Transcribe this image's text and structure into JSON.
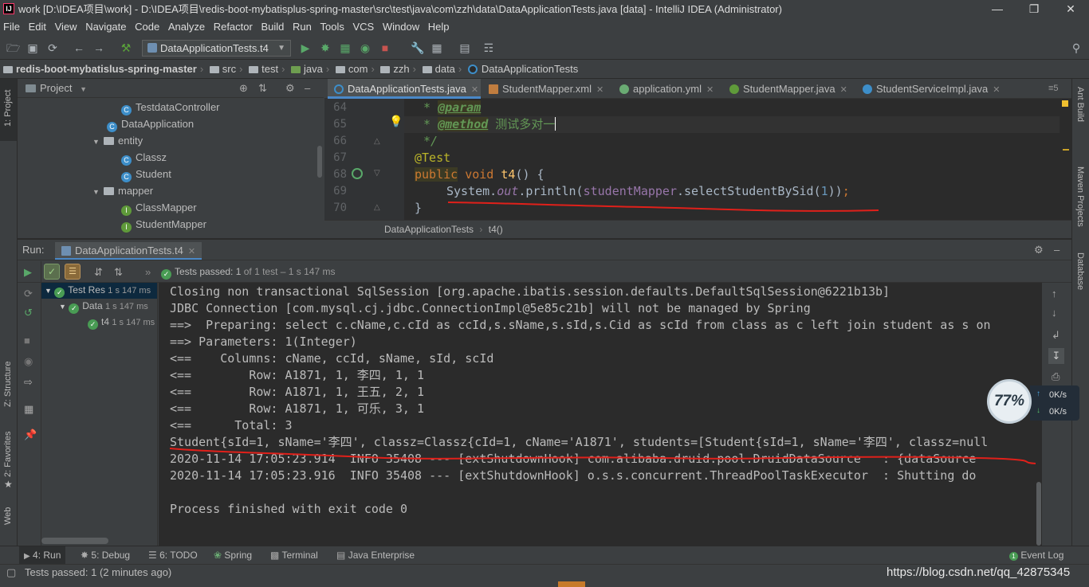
{
  "window": {
    "title": "work [D:\\IDEA项目\\work] - D:\\IDEA项目\\redis-boot-mybatisplus-spring-master\\src\\test\\java\\com\\zzh\\data\\DataApplicationTests.java [data] - IntelliJ IDEA (Administrator)",
    "app_icon": "IJ"
  },
  "menu": [
    "File",
    "Edit",
    "View",
    "Navigate",
    "Code",
    "Analyze",
    "Refactor",
    "Build",
    "Run",
    "Tools",
    "VCS",
    "Window",
    "Help"
  ],
  "toolbar": {
    "run_config": "DataApplicationTests.t4"
  },
  "breadcrumb": [
    "redis-boot-mybatislus-spring-master",
    "src",
    "test",
    "java",
    "com",
    "zzh",
    "data",
    "DataApplicationTests"
  ],
  "left_stripe": {
    "project": "1: Project",
    "structure": "Z: Structure",
    "favorites": "2: Favorites",
    "web": "Web"
  },
  "right_stripe": {
    "ant": "Ant Build",
    "maven": "Maven Projects",
    "database": "Database"
  },
  "project_panel": {
    "title": "Project",
    "items": [
      {
        "label": "TestdataController",
        "kind": "class"
      },
      {
        "label": "DataApplication",
        "kind": "class"
      },
      {
        "label": "entity",
        "kind": "package"
      },
      {
        "label": "Classz",
        "kind": "class"
      },
      {
        "label": "Student",
        "kind": "class"
      },
      {
        "label": "mapper",
        "kind": "package"
      },
      {
        "label": "ClassMapper",
        "kind": "interface"
      },
      {
        "label": "StudentMapper",
        "kind": "interface"
      }
    ]
  },
  "editor": {
    "tabs": [
      {
        "label": "DataApplicationTests.java",
        "active": true
      },
      {
        "label": "StudentMapper.xml",
        "active": false
      },
      {
        "label": "application.yml",
        "active": false
      },
      {
        "label": "StudentMapper.java",
        "active": false
      },
      {
        "label": "StudentServiceImpl.java",
        "active": false
      }
    ],
    "line_numbers": [
      "64",
      "65",
      "66",
      "67",
      "68",
      "69",
      "70"
    ],
    "code": {
      "l64_star": "* ",
      "l64_tag": "@param",
      "l65_star": "* ",
      "l65_tag": "@method",
      "l65_text": " 测试多对一",
      "l66": "*/",
      "l67": "@Test",
      "l68_kw1": "public",
      "l68_kw2": " void ",
      "l68_fn": "t4",
      "l68_rest": "() {",
      "l69_a": "System.",
      "l69_out": "out",
      "l69_b": ".println(",
      "l69_field": "studentMapper",
      "l69_c": ".selectStudentBySid(",
      "l69_num": "1",
      "l69_d": "))",
      "l69_semi": ";",
      "l70": "}"
    },
    "crumb_class": "DataApplicationTests",
    "crumb_method": "t4()"
  },
  "run": {
    "label": "Run:",
    "tab": "DataApplicationTests.t4",
    "status_prefix": "Tests passed:",
    "status_count": "1",
    "status_suffix": "of 1 test – 1 s 147 ms",
    "tree": [
      {
        "label": "Test Res",
        "time": "1 s 147 ms"
      },
      {
        "label": "Data",
        "time": "1 s 147 ms"
      },
      {
        "label": "t4",
        "time": "1 s 147 ms"
      }
    ],
    "console": [
      "Closing non transactional SqlSession [org.apache.ibatis.session.defaults.DefaultSqlSession@6221b13b]",
      "JDBC Connection [com.mysql.cj.jdbc.ConnectionImpl@5e85c21b] will not be managed by Spring",
      "==>  Preparing: select c.cName,c.cId as ccId,s.sName,s.sId,s.Cid as scId from class as c left join student as s on",
      "==> Parameters: 1(Integer)",
      "<==    Columns: cName, ccId, sName, sId, scId",
      "<==        Row: A1871, 1, 李四, 1, 1",
      "<==        Row: A1871, 1, 王五, 2, 1",
      "<==        Row: A1871, 1, 可乐, 3, 1",
      "<==      Total: 3",
      "Student{sId=1, sName='李四', classz=Classz{cId=1, cName='A1871', students=[Student{sId=1, sName='李四', classz=null",
      "2020-11-14 17:05:23.914  INFO 35408 --- [extShutdownHook] com.alibaba.druid.pool.DruidDataSource   : {dataSource",
      "2020-11-14 17:05:23.916  INFO 35408 --- [extShutdownHook] o.s.s.concurrent.ThreadPoolTaskExecutor  : Shutting do",
      "",
      "Process finished with exit code 0"
    ]
  },
  "bottom_tabs": [
    {
      "label": "4: Run",
      "active": true
    },
    {
      "label": "5: Debug",
      "active": false
    },
    {
      "label": "6: TODO",
      "active": false
    },
    {
      "label": "Spring",
      "active": false
    },
    {
      "label": "Terminal",
      "active": false
    },
    {
      "label": "Java Enterprise",
      "active": false
    }
  ],
  "event_log": "Event Log",
  "status": {
    "text": "Tests passed: 1 (2 minutes ago)",
    "watermark": "https://blog.csdn.net/qq_42875345"
  },
  "speed_widget": {
    "percent": "77%",
    "up": "0K/s",
    "down": "0K/s"
  }
}
